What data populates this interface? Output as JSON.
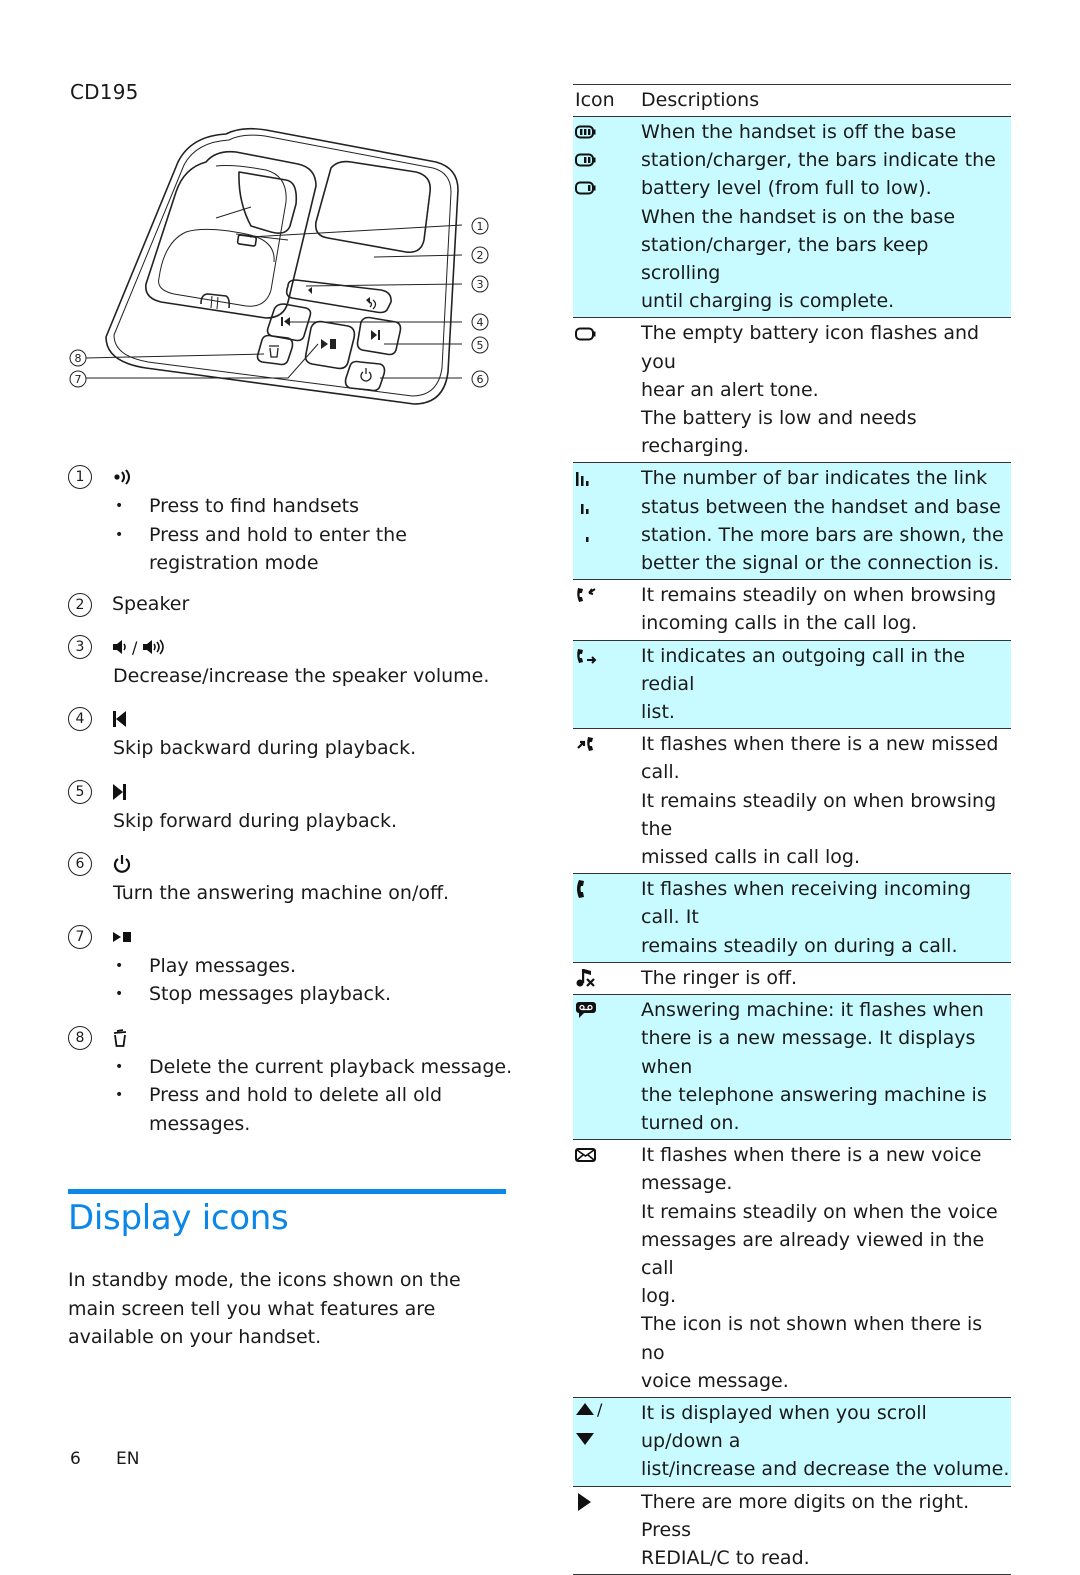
{
  "model": "CD195",
  "diagram": {
    "callouts": [
      "1",
      "2",
      "3",
      "4",
      "5",
      "6",
      "7",
      "8"
    ],
    "description": "Base station illustration with numbered callouts"
  },
  "legend": [
    {
      "num": "1",
      "icon": "find-handset-icon",
      "title": "",
      "body": "",
      "bullets": [
        "Press to find handsets",
        "Press and hold to enter the registration mode"
      ]
    },
    {
      "num": "2",
      "icon": "",
      "title": "Speaker",
      "body": "",
      "bullets": []
    },
    {
      "num": "3",
      "icon": "volume-down-up-icon",
      "title": "",
      "body": "Decrease/increase the speaker volume.",
      "bullets": []
    },
    {
      "num": "4",
      "icon": "skip-backward-icon",
      "title": "",
      "body": "Skip backward during playback.",
      "bullets": []
    },
    {
      "num": "5",
      "icon": "skip-forward-icon",
      "title": "",
      "body": "Skip forward during playback.",
      "bullets": []
    },
    {
      "num": "6",
      "icon": "power-icon",
      "title": "",
      "body": "Turn the answering machine on/off.",
      "bullets": []
    },
    {
      "num": "7",
      "icon": "play-stop-icon",
      "title": "",
      "body": "",
      "bullets": [
        "Play messages.",
        "Stop messages playback."
      ]
    },
    {
      "num": "8",
      "icon": "delete-icon",
      "title": "",
      "body": "",
      "bullets": [
        "Delete the current playback message.",
        "Press and hold to delete all old messages."
      ]
    }
  ],
  "section": {
    "heading": "Display icons",
    "intro": "In standby mode, the icons shown on the main screen tell you what features are available on your handset.",
    "accent_color": "#0a87e8"
  },
  "table": {
    "headers": {
      "icon": "Icon",
      "desc": "Descriptions"
    },
    "shade_color": "#c8fbff",
    "rows": [
      {
        "icons": [
          "battery-full-icon",
          "battery-two-bars-icon",
          "battery-one-bar-icon"
        ],
        "shaded": true,
        "lines": [
          "When the handset is off the base",
          "station/charger, the bars indicate the",
          "battery level (from full to low).",
          "When the handset is on the base",
          "station/charger, the bars keep scrolling",
          "until charging is complete."
        ]
      },
      {
        "icons": [
          "battery-empty-icon"
        ],
        "shaded": false,
        "lines": [
          "The empty battery icon flashes and you",
          "hear an alert tone.",
          "The battery is low and needs recharging."
        ]
      },
      {
        "icons": [
          "signal-three-bars-icon",
          "signal-two-bars-icon",
          "signal-one-bar-icon"
        ],
        "shaded": true,
        "lines": [
          "The number of bar indicates the link",
          "status between the handset and base",
          "station. The more bars are shown, the",
          "better the signal or the connection is."
        ]
      },
      {
        "icons": [
          "incoming-call-icon"
        ],
        "shaded": false,
        "lines": [
          "It remains steadily on when browsing",
          "incoming calls in the call log."
        ]
      },
      {
        "icons": [
          "outgoing-call-icon"
        ],
        "shaded": true,
        "lines": [
          "It indicates an outgoing call in the redial",
          "list."
        ]
      },
      {
        "icons": [
          "missed-call-icon"
        ],
        "shaded": false,
        "lines": [
          "It flashes when there is a new missed",
          "call.",
          "It remains steadily on when browsing the",
          "missed calls in call log."
        ]
      },
      {
        "icons": [
          "phone-icon"
        ],
        "shaded": true,
        "lines": [
          "It flashes when receiving incoming call. It",
          "remains steadily on during a call."
        ]
      },
      {
        "icons": [
          "ringer-off-icon"
        ],
        "shaded": false,
        "lines": [
          "The ringer is off."
        ]
      },
      {
        "icons": [
          "answering-machine-icon"
        ],
        "shaded": true,
        "lines": [
          "Answering machine: it flashes when",
          "there is a new message. It displays when",
          "the telephone answering machine is",
          "turned on."
        ]
      },
      {
        "icons": [
          "envelope-icon"
        ],
        "shaded": false,
        "lines": [
          "It flashes when there is a new voice",
          "message.",
          "It remains steadily on when the voice",
          "messages are already viewed in the call",
          "log.",
          "The icon is not shown when there is no",
          "voice message."
        ]
      },
      {
        "icons": [
          "arrow-up-down-icon"
        ],
        "shaded": true,
        "lines": [
          "It is displayed when you scroll up/down a",
          "list/increase and decrease the volume."
        ]
      },
      {
        "icons": [
          "arrow-right-icon"
        ],
        "shaded": false,
        "lines": [
          "There are more digits on the right. Press",
          "REDIAL/C to read."
        ]
      }
    ]
  },
  "footer": {
    "page_number": "6",
    "language": "EN"
  }
}
